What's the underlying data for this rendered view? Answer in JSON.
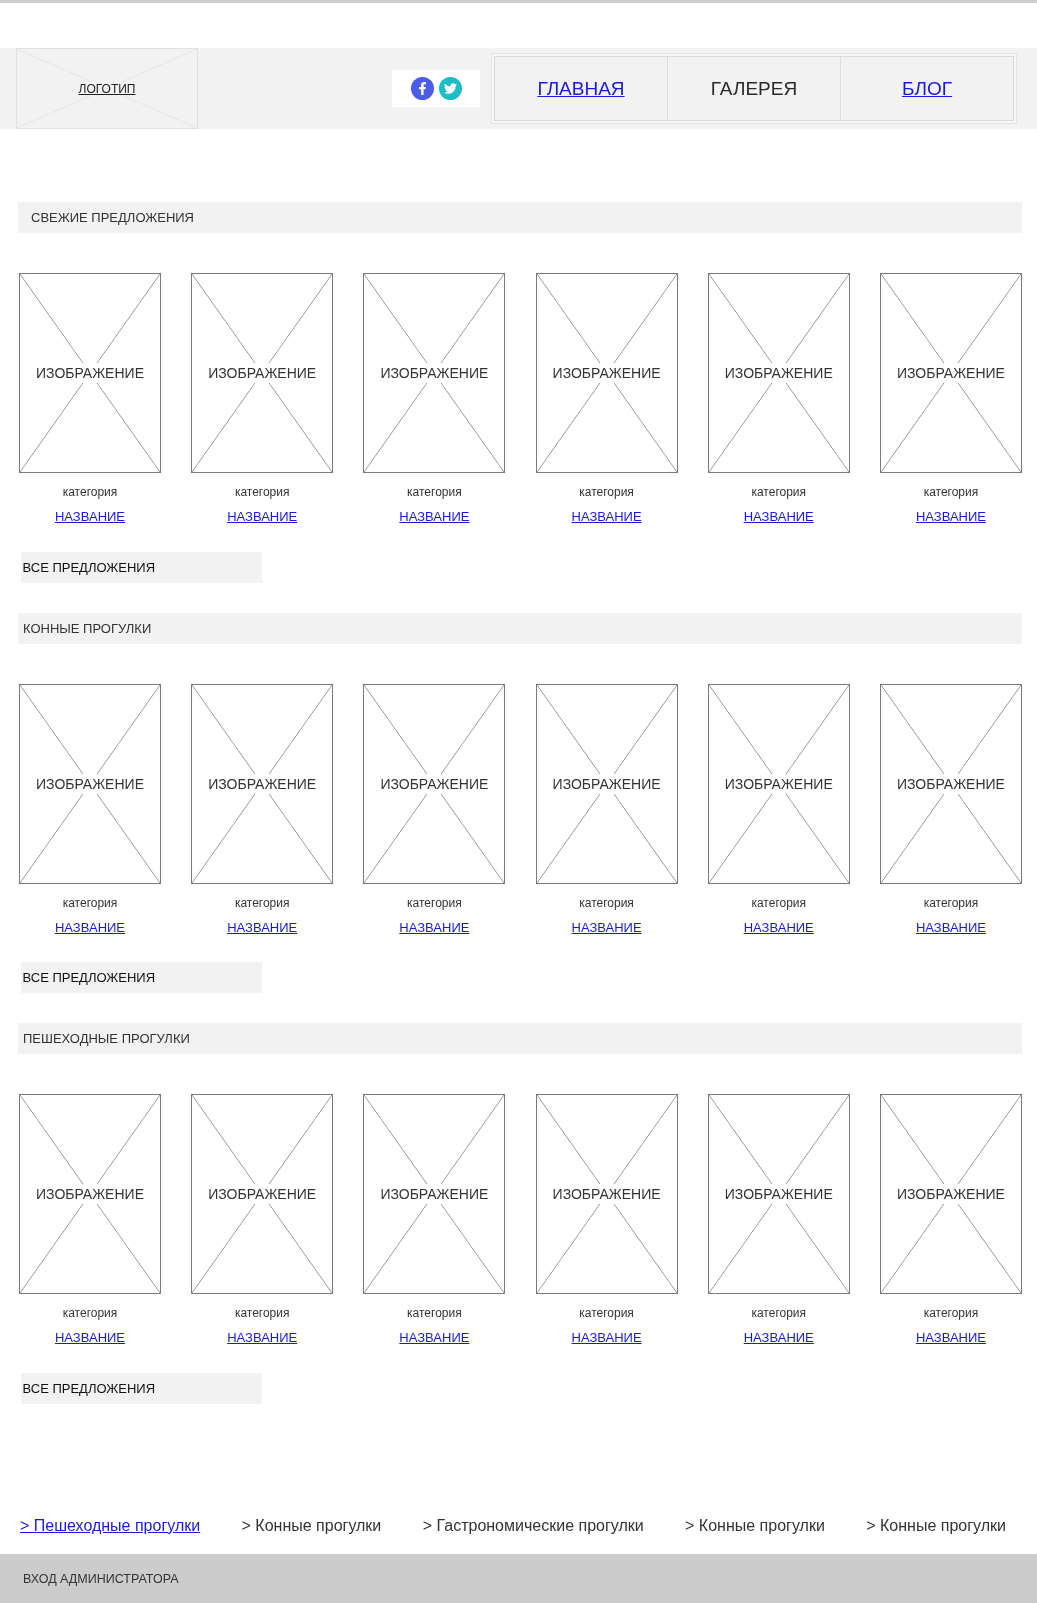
{
  "header": {
    "logo": "ЛОГОТИП",
    "nav": [
      {
        "label": "ГЛАВНАЯ",
        "selected": false
      },
      {
        "label": "ГАЛЕРЕЯ",
        "selected": true
      },
      {
        "label": "БЛОГ",
        "selected": false
      }
    ]
  },
  "sections": [
    {
      "title": "СВЕЖИЕ ПРЕДЛОЖЕНИЯ",
      "cards": [
        {
          "image": "ИЗОБРАЖЕНИЕ",
          "category": "категория",
          "name": "НАЗВАНИЕ"
        },
        {
          "image": "ИЗОБРАЖЕНИЕ",
          "category": "категория",
          "name": "НАЗВАНИЕ"
        },
        {
          "image": "ИЗОБРАЖЕНИЕ",
          "category": "категория",
          "name": "НАЗВАНИЕ"
        },
        {
          "image": "ИЗОБРАЖЕНИЕ",
          "category": "категория",
          "name": "НАЗВАНИЕ"
        },
        {
          "image": "ИЗОБРАЖЕНИЕ",
          "category": "категория",
          "name": "НАЗВАНИЕ"
        },
        {
          "image": "ИЗОБРАЖЕНИЕ",
          "category": "категория",
          "name": "НАЗВАНИЕ"
        }
      ],
      "more_button": "ВСЕ ПРЕДЛОЖЕНИЯ"
    },
    {
      "title": "КОННЫЕ ПРОГУЛКИ",
      "cards": [
        {
          "image": "ИЗОБРАЖЕНИЕ",
          "category": "категория",
          "name": "НАЗВАНИЕ"
        },
        {
          "image": "ИЗОБРАЖЕНИЕ",
          "category": "категория",
          "name": "НАЗВАНИЕ"
        },
        {
          "image": "ИЗОБРАЖЕНИЕ",
          "category": "категория",
          "name": "НАЗВАНИЕ"
        },
        {
          "image": "ИЗОБРАЖЕНИЕ",
          "category": "категория",
          "name": "НАЗВАНИЕ"
        },
        {
          "image": "ИЗОБРАЖЕНИЕ",
          "category": "категория",
          "name": "НАЗВАНИЕ"
        },
        {
          "image": "ИЗОБРАЖЕНИЕ",
          "category": "категория",
          "name": "НАЗВАНИЕ"
        }
      ],
      "more_button": "ВСЕ ПРЕДЛОЖЕНИЯ"
    },
    {
      "title": "ПЕШЕХОДНЫЕ ПРОГУЛКИ",
      "cards": [
        {
          "image": "ИЗОБРАЖЕНИЕ",
          "category": "категория",
          "name": "НАЗВАНИЕ"
        },
        {
          "image": "ИЗОБРАЖЕНИЕ",
          "category": "категория",
          "name": "НАЗВАНИЕ"
        },
        {
          "image": "ИЗОБРАЖЕНИЕ",
          "category": "категория",
          "name": "НАЗВАНИЕ"
        },
        {
          "image": "ИЗОБРАЖЕНИЕ",
          "category": "категория",
          "name": "НАЗВАНИЕ"
        },
        {
          "image": "ИЗОБРАЖЕНИЕ",
          "category": "категория",
          "name": "НАЗВАНИЕ"
        },
        {
          "image": "ИЗОБРАЖЕНИЕ",
          "category": "категория",
          "name": "НАЗВАНИЕ"
        }
      ],
      "more_button": "ВСЕ ПРЕДЛОЖЕНИЯ"
    }
  ],
  "footer_links": [
    {
      "label": "> Пешеходные прогулки",
      "kind": "link"
    },
    {
      "label": "> Конные прогулки",
      "kind": "text"
    },
    {
      "label": "> Гастрономические прогулки",
      "kind": "text"
    },
    {
      "label": "> Конные прогулки",
      "kind": "text"
    },
    {
      "label": "> Конные прогулки",
      "kind": "text"
    }
  ],
  "footer": {
    "admin_login": "ВХОД АДМИНИСТРАТОРА"
  }
}
